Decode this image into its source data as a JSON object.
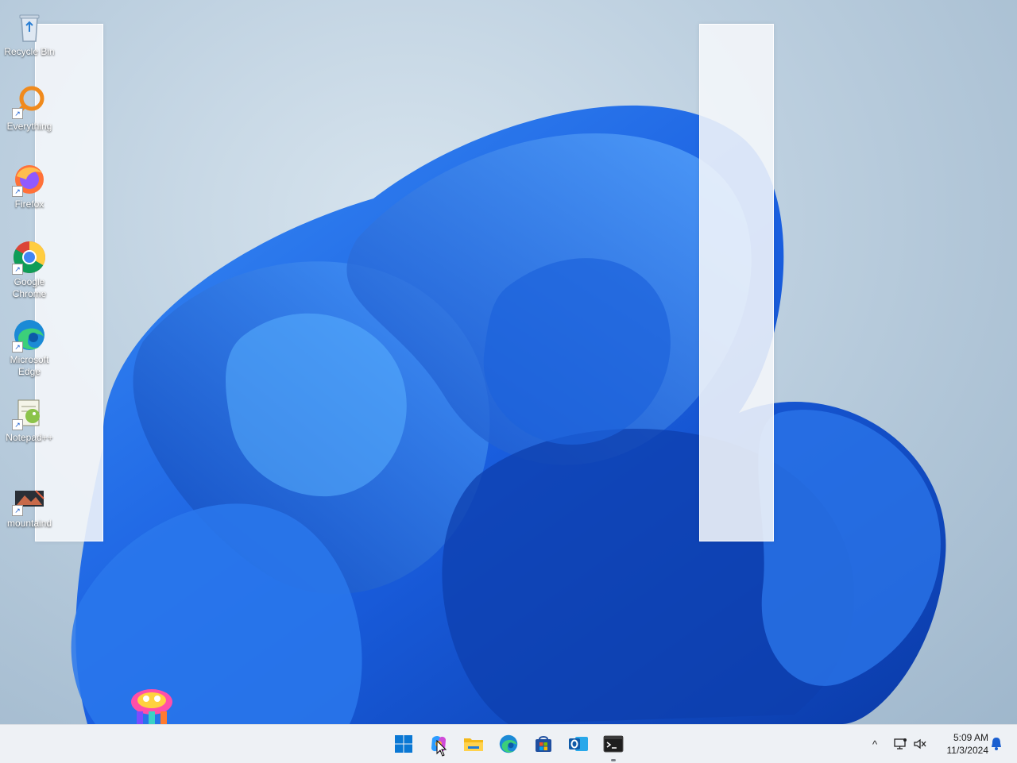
{
  "desktop": {
    "icons": [
      {
        "label": "Recycle Bin",
        "icon": "recycle-bin-icon"
      },
      {
        "label": "Everything",
        "icon": "everything-search-icon"
      },
      {
        "label": "Firefox",
        "icon": "firefox-icon"
      },
      {
        "label": "Google Chrome",
        "icon": "chrome-icon"
      },
      {
        "label": "Microsoft Edge",
        "icon": "edge-icon"
      },
      {
        "label": "Notepad++",
        "icon": "notepadpp-icon"
      },
      {
        "label": "mountaind",
        "icon": "mountain-app-icon"
      }
    ]
  },
  "taskbar": {
    "apps": [
      {
        "name": "Start",
        "icon": "windows-start-icon"
      },
      {
        "name": "Copilot",
        "icon": "copilot-icon"
      },
      {
        "name": "File Explorer",
        "icon": "file-explorer-icon"
      },
      {
        "name": "Microsoft Edge",
        "icon": "edge-icon"
      },
      {
        "name": "Microsoft Store",
        "icon": "store-icon"
      },
      {
        "name": "Outlook",
        "icon": "outlook-icon"
      },
      {
        "name": "Terminal",
        "icon": "terminal-icon"
      }
    ],
    "tray": {
      "chevron": "^",
      "time": "5:09 AM",
      "date": "11/3/2024"
    }
  },
  "colors": {
    "accent": "#1a5fd0",
    "bloom_dark": "#0b3fb0",
    "bloom_light": "#3c8cf5",
    "taskbar_bg": "#eef1f5"
  }
}
